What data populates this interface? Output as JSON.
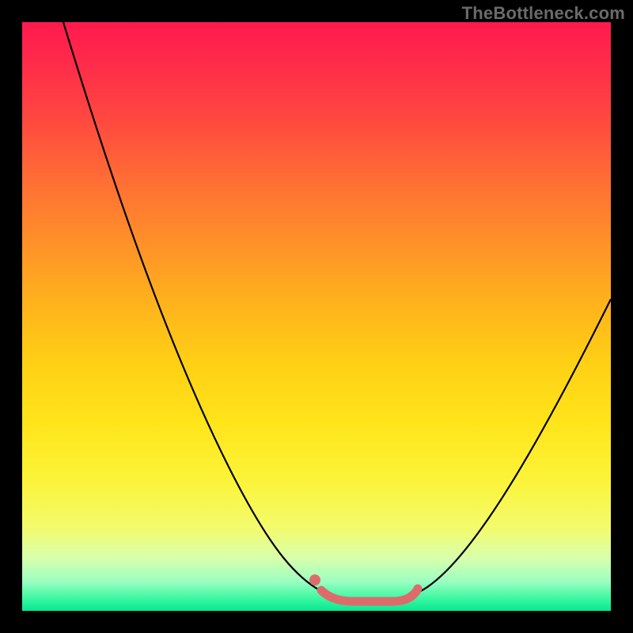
{
  "watermark": {
    "text": "TheBottleneck.com"
  },
  "chart_data": {
    "type": "line",
    "title": "",
    "xlabel": "",
    "ylabel": "",
    "xlim": [
      0,
      100
    ],
    "ylim": [
      0,
      100
    ],
    "grid": false,
    "legend": false,
    "background_gradient": {
      "top": "#ff1a4d",
      "bottom": "#07e88f"
    },
    "series": [
      {
        "name": "bottleneck-curve",
        "x": [
          7,
          12,
          18,
          24,
          30,
          36,
          42,
          46,
          50,
          54,
          58,
          62,
          66,
          70,
          76,
          82,
          88,
          94,
          100
        ],
        "values": [
          100,
          85,
          70,
          56,
          43,
          31,
          20,
          12,
          6,
          2,
          0,
          0,
          2,
          6,
          14,
          24,
          35,
          47,
          60
        ]
      }
    ],
    "annotations": [
      {
        "name": "optimal-range-marker",
        "type": "range",
        "x_start": 50,
        "x_end": 66,
        "y": 0,
        "color": "#de6b6c"
      }
    ]
  }
}
